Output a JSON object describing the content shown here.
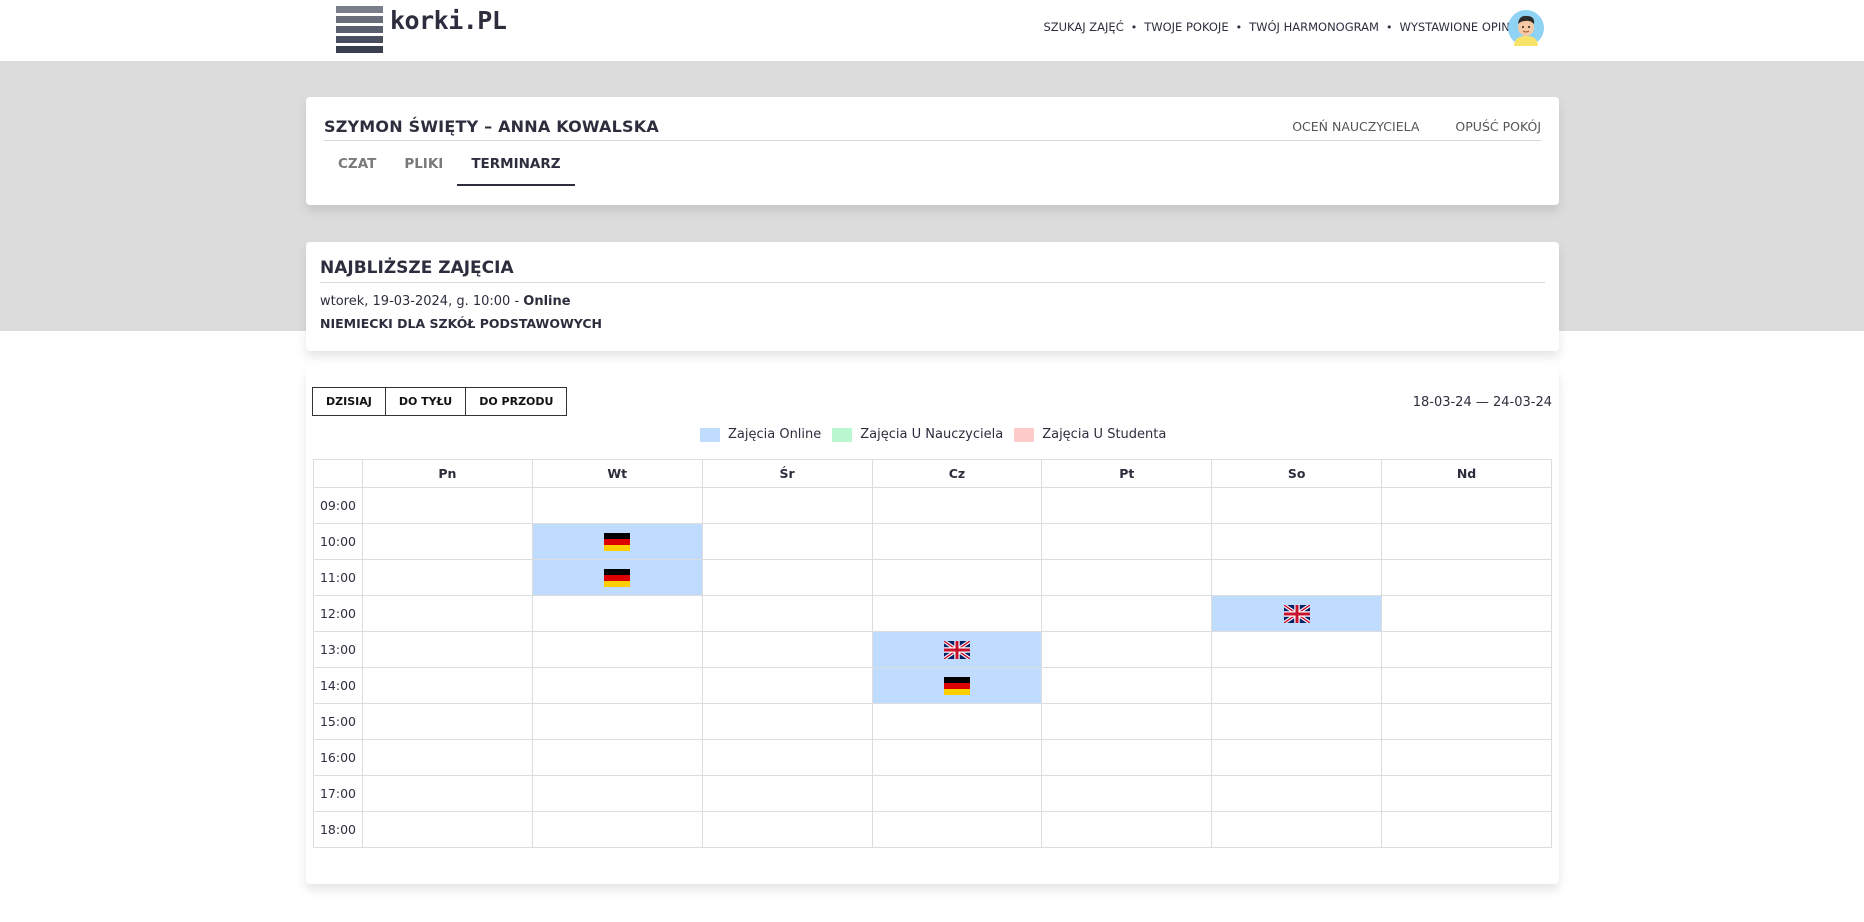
{
  "header": {
    "logo_text": "korki.PL",
    "logo_color": "#5a5f6e",
    "nav": [
      {
        "label": "SZUKAJ ZAJĘĆ"
      },
      {
        "label": "TWOJE POKOJE"
      },
      {
        "label": "TWÓJ HARMONOGRAM"
      },
      {
        "label": "WYSTAWIONE OPINIE"
      }
    ],
    "separator": "•"
  },
  "room": {
    "title": "SZYMON ŚWIĘTY – ANNA KOWALSKA",
    "rate_teacher": "OCEŃ NAUCZYCIELA",
    "leave_room": "OPUŚĆ POKÓJ",
    "tabs": [
      {
        "label": "CZAT",
        "active": false
      },
      {
        "label": "PLIKI",
        "active": false
      },
      {
        "label": "TERMINARZ",
        "active": true
      }
    ]
  },
  "next_lesson": {
    "heading": "NAJBLIŻSZE ZAJĘCIA",
    "when": "wtorek, 19-03-2024, g. 10:00 - ",
    "mode": "Online",
    "subject": "NIEMIECKI DLA SZKÓŁ PODSTAWOWYCH"
  },
  "calendar": {
    "buttons": {
      "today": "DZISIAJ",
      "back": "DO TYŁU",
      "forward": "DO PRZODU"
    },
    "range": "18-03-24 — 24-03-24",
    "legend": [
      {
        "label": "Zajęcia Online",
        "color": "#bfdbfe"
      },
      {
        "label": "Zajęcia U Nauczyciela",
        "color": "#bbf7d0"
      },
      {
        "label": "Zajęcia U Studenta",
        "color": "#fecaca"
      }
    ],
    "days": [
      "Pn",
      "Wt",
      "Śr",
      "Cz",
      "Pt",
      "So",
      "Nd"
    ],
    "hours": [
      "09:00",
      "10:00",
      "11:00",
      "12:00",
      "13:00",
      "14:00",
      "15:00",
      "16:00",
      "17:00",
      "18:00"
    ],
    "events": [
      {
        "day": "Wt",
        "hour": "10:00",
        "type": "online",
        "flag": "de-flag-icon"
      },
      {
        "day": "Wt",
        "hour": "11:00",
        "type": "online",
        "flag": "de-flag-icon"
      },
      {
        "day": "So",
        "hour": "12:00",
        "type": "online",
        "flag": "gb-flag-icon"
      },
      {
        "day": "Cz",
        "hour": "13:00",
        "type": "online",
        "flag": "gb-flag-icon"
      },
      {
        "day": "Cz",
        "hour": "14:00",
        "type": "online",
        "flag": "de-flag-icon"
      }
    ]
  }
}
